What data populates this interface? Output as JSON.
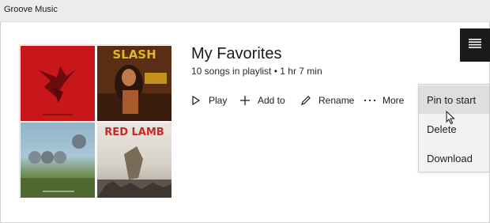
{
  "window": {
    "title": "Groove Music"
  },
  "playlist": {
    "title": "My Favorites",
    "meta": "10 songs in playlist • 1 hr 7 min",
    "art_icons": [
      "red-album-art-icon",
      "slash-album-art-icon",
      "spheres-album-art-icon",
      "red-lamb-album-art-icon"
    ],
    "art_texts": {
      "slash": "SLASH",
      "red_lamb": "RED LAMB"
    }
  },
  "actions": {
    "play": "Play",
    "add_to": "Add to",
    "rename": "Rename",
    "more": "More"
  },
  "context_menu": {
    "items": [
      {
        "label": "Pin to start",
        "hovered": true
      },
      {
        "label": "Delete"
      },
      {
        "label": "Download"
      }
    ]
  },
  "icons": {
    "play": "play-icon",
    "add": "plus-icon",
    "rename": "pencil-icon",
    "more": "ellipsis-icon",
    "nav": "hamburger-menu-icon"
  },
  "colors": {
    "title_bar": "#ececec",
    "menu_bg": "#f2f2f2",
    "menu_hover": "#dedede",
    "nav_button": "#1a1a1a"
  }
}
